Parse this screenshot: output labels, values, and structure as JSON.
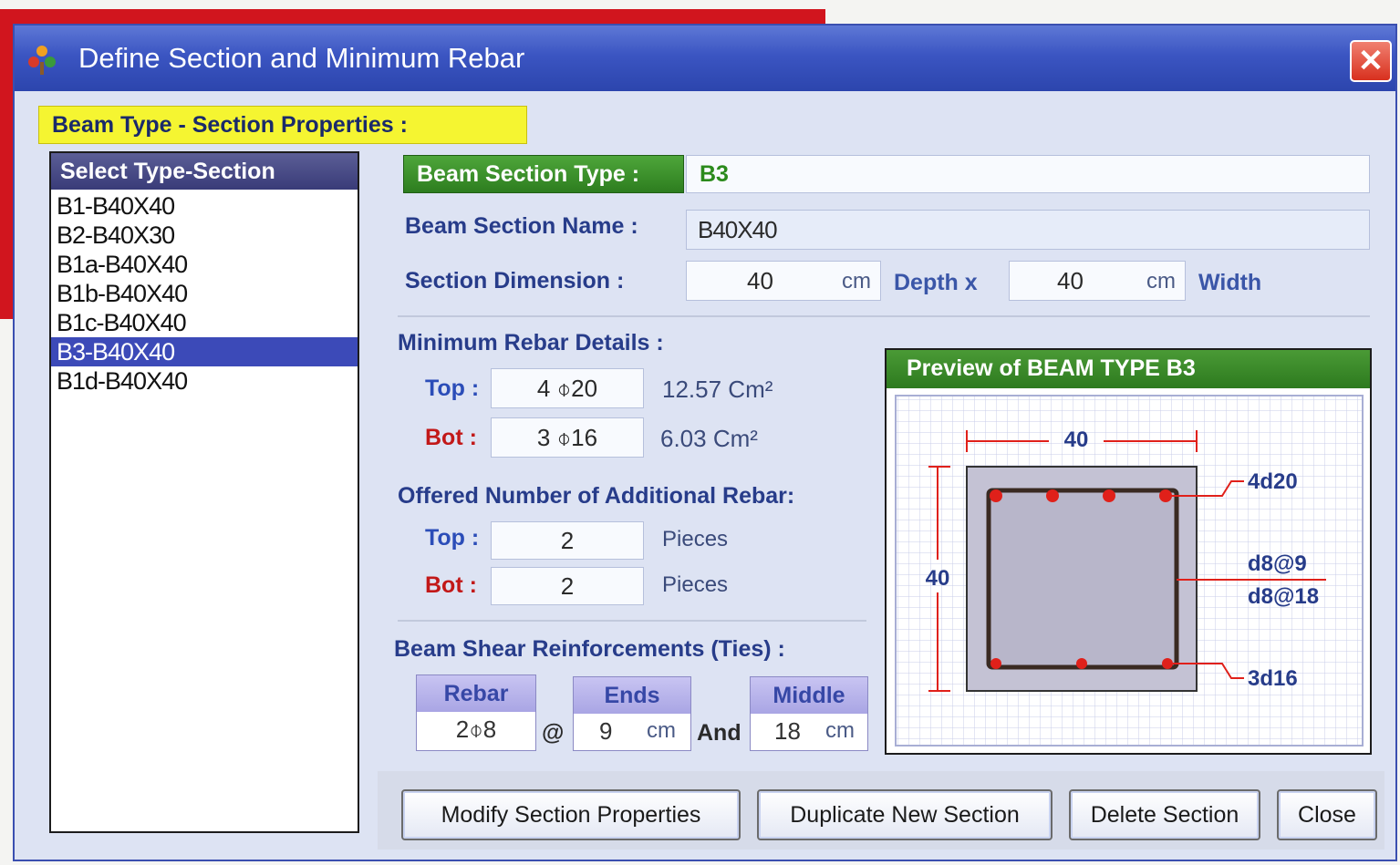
{
  "window": {
    "title": "Define Section and Minimum Rebar",
    "close_label": "✕"
  },
  "group": {
    "title": "Beam Type - Section Properties :"
  },
  "list": {
    "header": "Select  Type-Section",
    "items": [
      {
        "label": "B1-B40X40"
      },
      {
        "label": "B2-B40X30"
      },
      {
        "label": "B1a-B40X40"
      },
      {
        "label": "B1b-B40X40"
      },
      {
        "label": "B1c-B40X40"
      },
      {
        "label": "B3-B40X40",
        "selected": true
      },
      {
        "label": "B1d-B40X40"
      }
    ]
  },
  "section": {
    "type_label": "Beam Section Type :",
    "type_value": "B3",
    "name_label": "Beam Section Name :",
    "name_value": "B40X40",
    "dimension_label": "Section Dimension :",
    "depth_value": "40",
    "depth_unit": "cm",
    "depth_label": "Depth x",
    "width_value": "40",
    "width_unit": "cm",
    "width_label": "Width"
  },
  "min_rebar": {
    "title": "Minimum Rebar Details :",
    "top_label": "Top :",
    "top_value": "4 ⌽20",
    "top_area": "12.57 Cm²",
    "bot_label": "Bot :",
    "bot_value": "3 ⌽16",
    "bot_area": "6.03 Cm²"
  },
  "additional": {
    "title": "Offered Number of Additional Rebar:",
    "top_label": "Top :",
    "top_value": "2",
    "top_unit": "Pieces",
    "bot_label": "Bot :",
    "bot_value": "2",
    "bot_unit": "Pieces"
  },
  "shear": {
    "title": "Beam Shear Reinforcements (Ties) :",
    "rebar_head": "Rebar",
    "rebar_value": "2⌽8",
    "at_symbol": "@",
    "ends_head": "Ends",
    "ends_value": "9",
    "ends_unit": "cm",
    "and_label": "And",
    "middle_head": "Middle",
    "middle_value": "18",
    "middle_unit": "cm"
  },
  "preview": {
    "title": "Preview of BEAM TYPE B3",
    "width_dim": "40",
    "depth_dim": "40",
    "top_bars": "4d20",
    "tie_ends": "d8@9",
    "tie_middle": "d8@18",
    "bot_bars": "3d16"
  },
  "buttons": {
    "modify": "Modify Section Properties",
    "duplicate": "Duplicate New Section",
    "delete": "Delete Section",
    "close": "Close"
  },
  "colors": {
    "title_bar": "#3b55c2",
    "group_highlight": "#f5f531",
    "green_header": "#2d7d1f",
    "selection": "#3c4ab8",
    "rebar_red": "#d8201a"
  }
}
